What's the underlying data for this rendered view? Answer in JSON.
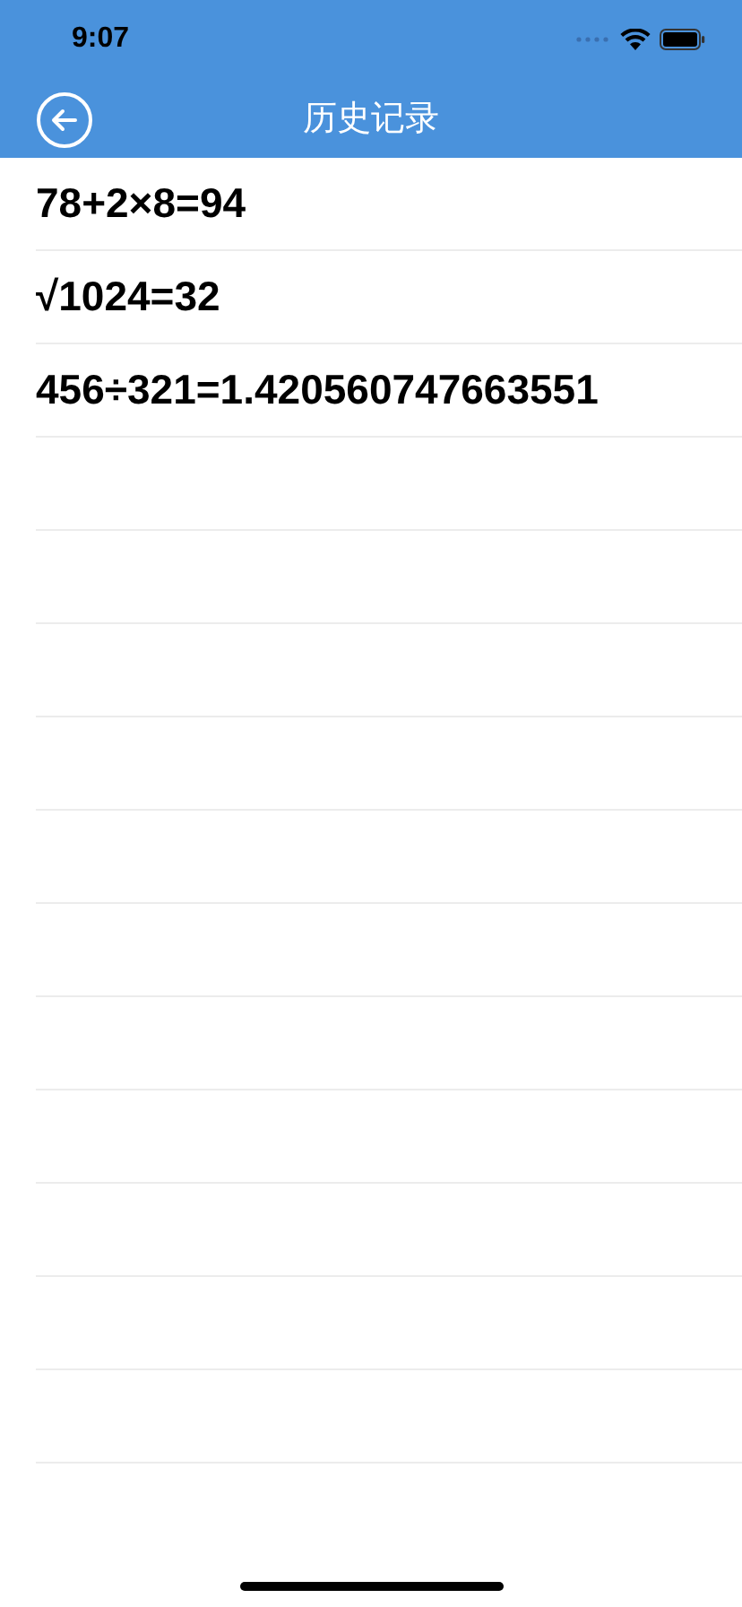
{
  "status_bar": {
    "time": "9:07"
  },
  "nav_bar": {
    "title": "历史记录"
  },
  "history": [
    {
      "text": "78+2×8=94"
    },
    {
      "text": "√1024=32"
    },
    {
      "text": "456÷321=1.420560747663551"
    }
  ]
}
